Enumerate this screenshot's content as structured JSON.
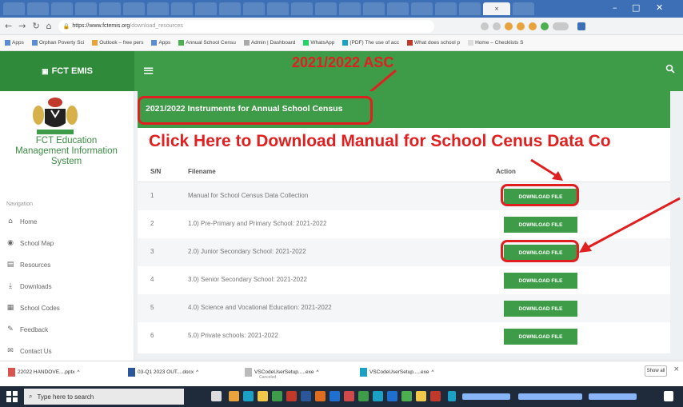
{
  "browser": {
    "url_host": "https://www.fctemis.org",
    "url_path": "/download_resources",
    "tabs": [
      "",
      "",
      "",
      "",
      "",
      "",
      "",
      "",
      "",
      "",
      "",
      "",
      "",
      "",
      "",
      "",
      "",
      "",
      "",
      "",
      "",
      "",
      "",
      "",
      "",
      ""
    ],
    "active_tab_label": "",
    "bookmarks": [
      "Apps",
      "Orphan Poverty Sci",
      "Outlook – free pers",
      "Apps",
      "Annual School Censu",
      "Admin | Dashboard",
      "WhatsApp",
      "(PDF) The use of acc",
      "What does school p",
      "Home – Checklists S"
    ]
  },
  "site": {
    "logo_text": "FCT EMIS",
    "brand_lines": [
      "FCT Education",
      "Management Information",
      "System"
    ]
  },
  "annotations": {
    "asc": "2021/2022 ASC",
    "click_here": "Click Here to Download Manual for School Cenus Data Co"
  },
  "sidebar": {
    "heading": "Navigation",
    "items": [
      {
        "label": "Home",
        "icon": "home-icon"
      },
      {
        "label": "School Map",
        "icon": "map-icon"
      },
      {
        "label": "Resources",
        "icon": "book-icon"
      },
      {
        "label": "Downloads",
        "icon": "download-icon"
      },
      {
        "label": "School Codes",
        "icon": "table-icon"
      },
      {
        "label": "Feedback",
        "icon": "feedback-icon"
      },
      {
        "label": "Contact Us",
        "icon": "envelope-icon"
      }
    ]
  },
  "panel": {
    "title": "2021/2022 Instruments for Annual School Census",
    "columns": {
      "sn": "S/N",
      "filename": "Filename",
      "action": "Action"
    },
    "button_label": "DOWNLOAD FILE",
    "rows": [
      {
        "sn": "1",
        "filename": "Manual for School Census Data Collection"
      },
      {
        "sn": "2",
        "filename": "1.0) Pre-Primary and Primary School: 2021-2022"
      },
      {
        "sn": "3",
        "filename": "2.0) Junior Secondary School: 2021-2022"
      },
      {
        "sn": "4",
        "filename": "3.0) Senior Secondary School: 2021-2022"
      },
      {
        "sn": "5",
        "filename": "4.0) Science and Vocational Education: 2021-2022"
      },
      {
        "sn": "6",
        "filename": "5.0) Private schools: 2021-2022"
      }
    ]
  },
  "downloads": {
    "items": [
      {
        "name": "22022 HANDOVE....pptx",
        "sub": ""
      },
      {
        "name": "03-Q1 2023 OUT....docx",
        "sub": ""
      },
      {
        "name": "VSCodeUserSetup.....exe",
        "sub": "Canceled"
      },
      {
        "name": "VSCodeUserSetup.....exe",
        "sub": ""
      }
    ],
    "show_all": "Show all"
  },
  "taskbar": {
    "search_placeholder": "Type here to search"
  },
  "colors": {
    "brand_green": "#3e9b48",
    "annotation_red": "#e02020"
  }
}
